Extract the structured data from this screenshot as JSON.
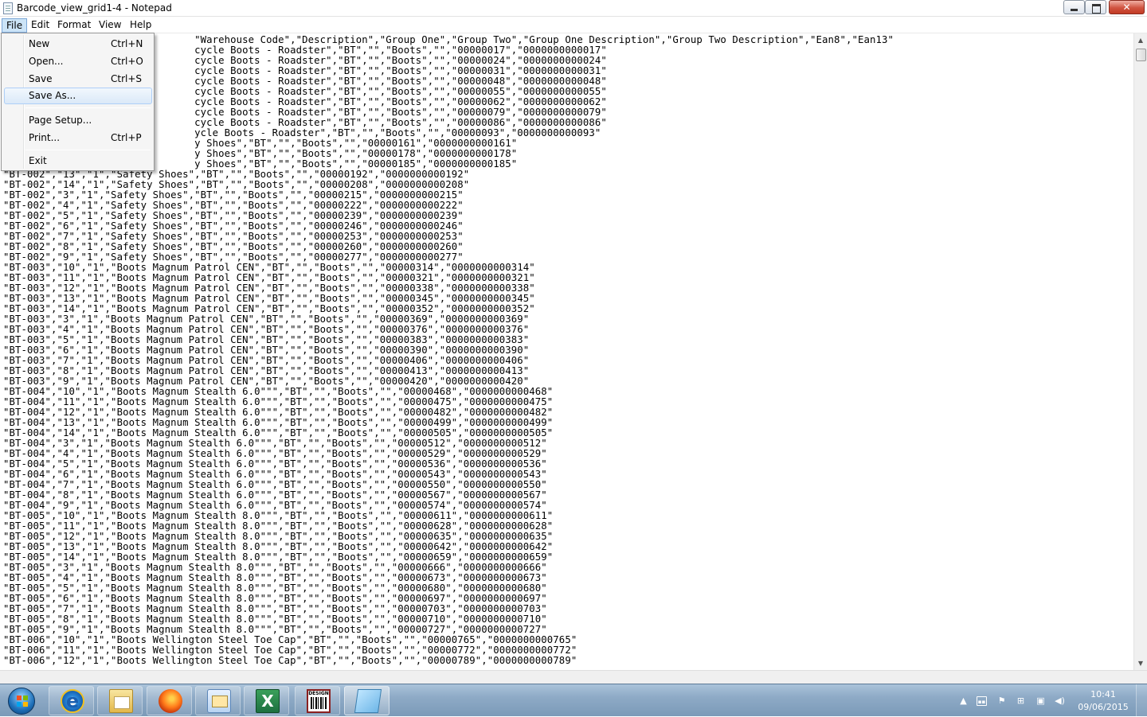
{
  "window": {
    "title": "Barcode_view_grid1-4 - Notepad"
  },
  "menubar": {
    "file": "File",
    "edit": "Edit",
    "format": "Format",
    "view": "View",
    "help": "Help"
  },
  "file_menu": {
    "items": [
      {
        "label": "New",
        "shortcut": "Ctrl+N"
      },
      {
        "label": "Open...",
        "shortcut": "Ctrl+O"
      },
      {
        "label": "Save",
        "shortcut": "Ctrl+S"
      },
      {
        "label": "Save As...",
        "shortcut": ""
      },
      {
        "label": "Page Setup...",
        "shortcut": ""
      },
      {
        "label": "Print...",
        "shortcut": "Ctrl+P"
      },
      {
        "label": "Exit",
        "shortcut": ""
      }
    ],
    "highlighted": "Save As..."
  },
  "editor": {
    "lines": [
      "                                \"Warehouse Code\",\"Description\",\"Group One\",\"Group Two\",\"Group One Description\",\"Group Two Description\",\"Ean8\",\"Ean13\"",
      "                                cycle Boots - Roadster\",\"BT\",\"\",\"Boots\",\"\",\"00000017\",\"0000000000017\"",
      "                                cycle Boots - Roadster\",\"BT\",\"\",\"Boots\",\"\",\"00000024\",\"0000000000024\"",
      "                                cycle Boots - Roadster\",\"BT\",\"\",\"Boots\",\"\",\"00000031\",\"0000000000031\"",
      "                                cycle Boots - Roadster\",\"BT\",\"\",\"Boots\",\"\",\"00000048\",\"0000000000048\"",
      "                                cycle Boots - Roadster\",\"BT\",\"\",\"Boots\",\"\",\"00000055\",\"0000000000055\"",
      "                                cycle Boots - Roadster\",\"BT\",\"\",\"Boots\",\"\",\"00000062\",\"0000000000062\"",
      "                                cycle Boots - Roadster\",\"BT\",\"\",\"Boots\",\"\",\"00000079\",\"0000000000079\"",
      "                                cycle Boots - Roadster\",\"BT\",\"\",\"Boots\",\"\",\"00000086\",\"0000000000086\"",
      "                                ycle Boots - Roadster\",\"BT\",\"\",\"Boots\",\"\",\"00000093\",\"0000000000093\"",
      "                                y Shoes\",\"BT\",\"\",\"Boots\",\"\",\"00000161\",\"0000000000161\"",
      "                                y Shoes\",\"BT\",\"\",\"Boots\",\"\",\"00000178\",\"0000000000178\"",
      "                                y Shoes\",\"BT\",\"\",\"Boots\",\"\",\"00000185\",\"0000000000185\"",
      "\"BT-002\",\"13\",\"1\",\"Safety Shoes\",\"BT\",\"\",\"Boots\",\"\",\"00000192\",\"0000000000192\"",
      "\"BT-002\",\"14\",\"1\",\"Safety Shoes\",\"BT\",\"\",\"Boots\",\"\",\"00000208\",\"0000000000208\"",
      "\"BT-002\",\"3\",\"1\",\"Safety Shoes\",\"BT\",\"\",\"Boots\",\"\",\"00000215\",\"0000000000215\"",
      "\"BT-002\",\"4\",\"1\",\"Safety Shoes\",\"BT\",\"\",\"Boots\",\"\",\"00000222\",\"0000000000222\"",
      "\"BT-002\",\"5\",\"1\",\"Safety Shoes\",\"BT\",\"\",\"Boots\",\"\",\"00000239\",\"0000000000239\"",
      "\"BT-002\",\"6\",\"1\",\"Safety Shoes\",\"BT\",\"\",\"Boots\",\"\",\"00000246\",\"0000000000246\"",
      "\"BT-002\",\"7\",\"1\",\"Safety Shoes\",\"BT\",\"\",\"Boots\",\"\",\"00000253\",\"0000000000253\"",
      "\"BT-002\",\"8\",\"1\",\"Safety Shoes\",\"BT\",\"\",\"Boots\",\"\",\"00000260\",\"0000000000260\"",
      "\"BT-002\",\"9\",\"1\",\"Safety Shoes\",\"BT\",\"\",\"Boots\",\"\",\"00000277\",\"0000000000277\"",
      "\"BT-003\",\"10\",\"1\",\"Boots Magnum Patrol CEN\",\"BT\",\"\",\"Boots\",\"\",\"00000314\",\"0000000000314\"",
      "\"BT-003\",\"11\",\"1\",\"Boots Magnum Patrol CEN\",\"BT\",\"\",\"Boots\",\"\",\"00000321\",\"0000000000321\"",
      "\"BT-003\",\"12\",\"1\",\"Boots Magnum Patrol CEN\",\"BT\",\"\",\"Boots\",\"\",\"00000338\",\"0000000000338\"",
      "\"BT-003\",\"13\",\"1\",\"Boots Magnum Patrol CEN\",\"BT\",\"\",\"Boots\",\"\",\"00000345\",\"0000000000345\"",
      "\"BT-003\",\"14\",\"1\",\"Boots Magnum Patrol CEN\",\"BT\",\"\",\"Boots\",\"\",\"00000352\",\"0000000000352\"",
      "\"BT-003\",\"3\",\"1\",\"Boots Magnum Patrol CEN\",\"BT\",\"\",\"Boots\",\"\",\"00000369\",\"0000000000369\"",
      "\"BT-003\",\"4\",\"1\",\"Boots Magnum Patrol CEN\",\"BT\",\"\",\"Boots\",\"\",\"00000376\",\"0000000000376\"",
      "\"BT-003\",\"5\",\"1\",\"Boots Magnum Patrol CEN\",\"BT\",\"\",\"Boots\",\"\",\"00000383\",\"0000000000383\"",
      "\"BT-003\",\"6\",\"1\",\"Boots Magnum Patrol CEN\",\"BT\",\"\",\"Boots\",\"\",\"00000390\",\"0000000000390\"",
      "\"BT-003\",\"7\",\"1\",\"Boots Magnum Patrol CEN\",\"BT\",\"\",\"Boots\",\"\",\"00000406\",\"0000000000406\"",
      "\"BT-003\",\"8\",\"1\",\"Boots Magnum Patrol CEN\",\"BT\",\"\",\"Boots\",\"\",\"00000413\",\"0000000000413\"",
      "\"BT-003\",\"9\",\"1\",\"Boots Magnum Patrol CEN\",\"BT\",\"\",\"Boots\",\"\",\"00000420\",\"0000000000420\"",
      "\"BT-004\",\"10\",\"1\",\"Boots Magnum Stealth 6.0\"\"\",\"BT\",\"\",\"Boots\",\"\",\"00000468\",\"0000000000468\"",
      "\"BT-004\",\"11\",\"1\",\"Boots Magnum Stealth 6.0\"\"\",\"BT\",\"\",\"Boots\",\"\",\"00000475\",\"0000000000475\"",
      "\"BT-004\",\"12\",\"1\",\"Boots Magnum Stealth 6.0\"\"\",\"BT\",\"\",\"Boots\",\"\",\"00000482\",\"0000000000482\"",
      "\"BT-004\",\"13\",\"1\",\"Boots Magnum Stealth 6.0\"\"\",\"BT\",\"\",\"Boots\",\"\",\"00000499\",\"0000000000499\"",
      "\"BT-004\",\"14\",\"1\",\"Boots Magnum Stealth 6.0\"\"\",\"BT\",\"\",\"Boots\",\"\",\"00000505\",\"0000000000505\"",
      "\"BT-004\",\"3\",\"1\",\"Boots Magnum Stealth 6.0\"\"\",\"BT\",\"\",\"Boots\",\"\",\"00000512\",\"0000000000512\"",
      "\"BT-004\",\"4\",\"1\",\"Boots Magnum Stealth 6.0\"\"\",\"BT\",\"\",\"Boots\",\"\",\"00000529\",\"0000000000529\"",
      "\"BT-004\",\"5\",\"1\",\"Boots Magnum Stealth 6.0\"\"\",\"BT\",\"\",\"Boots\",\"\",\"00000536\",\"0000000000536\"",
      "\"BT-004\",\"6\",\"1\",\"Boots Magnum Stealth 6.0\"\"\",\"BT\",\"\",\"Boots\",\"\",\"00000543\",\"0000000000543\"",
      "\"BT-004\",\"7\",\"1\",\"Boots Magnum Stealth 6.0\"\"\",\"BT\",\"\",\"Boots\",\"\",\"00000550\",\"0000000000550\"",
      "\"BT-004\",\"8\",\"1\",\"Boots Magnum Stealth 6.0\"\"\",\"BT\",\"\",\"Boots\",\"\",\"00000567\",\"0000000000567\"",
      "\"BT-004\",\"9\",\"1\",\"Boots Magnum Stealth 6.0\"\"\",\"BT\",\"\",\"Boots\",\"\",\"00000574\",\"0000000000574\"",
      "\"BT-005\",\"10\",\"1\",\"Boots Magnum Stealth 8.0\"\"\",\"BT\",\"\",\"Boots\",\"\",\"00000611\",\"0000000000611\"",
      "\"BT-005\",\"11\",\"1\",\"Boots Magnum Stealth 8.0\"\"\",\"BT\",\"\",\"Boots\",\"\",\"00000628\",\"0000000000628\"",
      "\"BT-005\",\"12\",\"1\",\"Boots Magnum Stealth 8.0\"\"\",\"BT\",\"\",\"Boots\",\"\",\"00000635\",\"0000000000635\"",
      "\"BT-005\",\"13\",\"1\",\"Boots Magnum Stealth 8.0\"\"\",\"BT\",\"\",\"Boots\",\"\",\"00000642\",\"0000000000642\"",
      "\"BT-005\",\"14\",\"1\",\"Boots Magnum Stealth 8.0\"\"\",\"BT\",\"\",\"Boots\",\"\",\"00000659\",\"0000000000659\"",
      "\"BT-005\",\"3\",\"1\",\"Boots Magnum Stealth 8.0\"\"\",\"BT\",\"\",\"Boots\",\"\",\"00000666\",\"0000000000666\"",
      "\"BT-005\",\"4\",\"1\",\"Boots Magnum Stealth 8.0\"\"\",\"BT\",\"\",\"Boots\",\"\",\"00000673\",\"0000000000673\"",
      "\"BT-005\",\"5\",\"1\",\"Boots Magnum Stealth 8.0\"\"\",\"BT\",\"\",\"Boots\",\"\",\"00000680\",\"0000000000680\"",
      "\"BT-005\",\"6\",\"1\",\"Boots Magnum Stealth 8.0\"\"\",\"BT\",\"\",\"Boots\",\"\",\"00000697\",\"0000000000697\"",
      "\"BT-005\",\"7\",\"1\",\"Boots Magnum Stealth 8.0\"\"\",\"BT\",\"\",\"Boots\",\"\",\"00000703\",\"0000000000703\"",
      "\"BT-005\",\"8\",\"1\",\"Boots Magnum Stealth 8.0\"\"\",\"BT\",\"\",\"Boots\",\"\",\"00000710\",\"0000000000710\"",
      "\"BT-005\",\"9\",\"1\",\"Boots Magnum Stealth 8.0\"\"\",\"BT\",\"\",\"Boots\",\"\",\"00000727\",\"0000000000727\"",
      "\"BT-006\",\"10\",\"1\",\"Boots Wellington Steel Toe Cap\",\"BT\",\"\",\"Boots\",\"\",\"00000765\",\"0000000000765\"",
      "\"BT-006\",\"11\",\"1\",\"Boots Wellington Steel Toe Cap\",\"BT\",\"\",\"Boots\",\"\",\"00000772\",\"0000000000772\"",
      "\"BT-006\",\"12\",\"1\",\"Boots Wellington Steel Toe Cap\",\"BT\",\"\",\"Boots\",\"\",\"00000789\",\"0000000000789\""
    ]
  },
  "taskbar": {
    "start_icon": "windows-start-icon",
    "apps": [
      {
        "name": "internet-explorer",
        "icon": "ie-icon"
      },
      {
        "name": "windows-explorer",
        "icon": "explorer-icon"
      },
      {
        "name": "firefox",
        "icon": "firefox-icon"
      },
      {
        "name": "mail",
        "icon": "mail-icon"
      },
      {
        "name": "excel",
        "icon": "excel-icon"
      },
      {
        "name": "barcode-design",
        "icon": "barcode-icon",
        "label": "DESIGN"
      },
      {
        "name": "notepad",
        "icon": "notepad-icon",
        "active": true
      }
    ],
    "tray": {
      "icons": [
        "show-hidden-icon",
        "keyboard-icon",
        "action-center-flag-icon",
        "windows-icon",
        "network-icon",
        "volume-icon"
      ],
      "time": "10:41",
      "date": "09/06/2015"
    }
  },
  "colors": {
    "menu_highlight": "#dbe9f8",
    "taskbar": "#8eaac6",
    "close_button": "#d05441"
  }
}
